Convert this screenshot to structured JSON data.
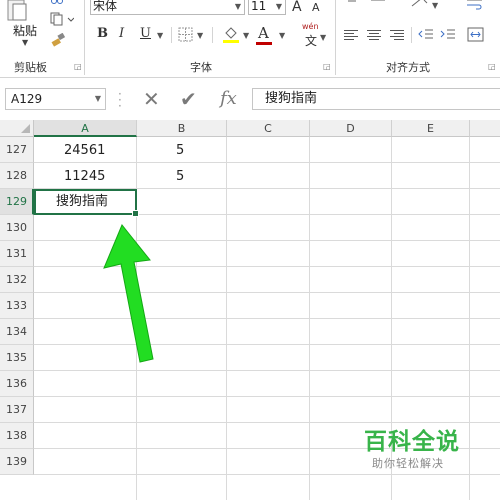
{
  "ribbon": {
    "clipboard": {
      "paste_label": "粘贴",
      "group_label": "剪贴板",
      "icons": [
        "paste-icon",
        "cut-icon",
        "copy-icon",
        "format-painter-icon"
      ]
    },
    "font": {
      "font_name": "宋体",
      "font_size": "11",
      "grow_label": "A",
      "shrink_label": "A",
      "bold_label": "B",
      "italic_label": "I",
      "underline_label": "U",
      "phonetic_label": "wén",
      "phonetic_sub": "文",
      "font_color": "#c00000",
      "group_label": "字体"
    },
    "alignment": {
      "group_label": "对齐方式"
    }
  },
  "formula_bar": {
    "name_box": "A129",
    "cancel_icon": "✕",
    "enter_icon": "✔",
    "fx_label": "fx",
    "content": "搜狗指南"
  },
  "sheet": {
    "columns": [
      "A",
      "B",
      "C",
      "D",
      "E"
    ],
    "selected_column": "A",
    "rows": [
      "127",
      "128",
      "129",
      "130",
      "131",
      "132",
      "133",
      "134",
      "135",
      "136",
      "137",
      "138",
      "139"
    ],
    "selected_row": "129",
    "cells": {
      "a127": "24561",
      "b127": "5",
      "a128": "11245",
      "b128": "5",
      "a129": "搜狗指南"
    }
  },
  "annotation": {
    "arrow_color": "#22dd22",
    "arrow_icon": "green-arrow-up-icon"
  },
  "watermark": {
    "title": "百科全说",
    "subtitle": "助你轻松解决",
    "color": "#38b44a"
  }
}
